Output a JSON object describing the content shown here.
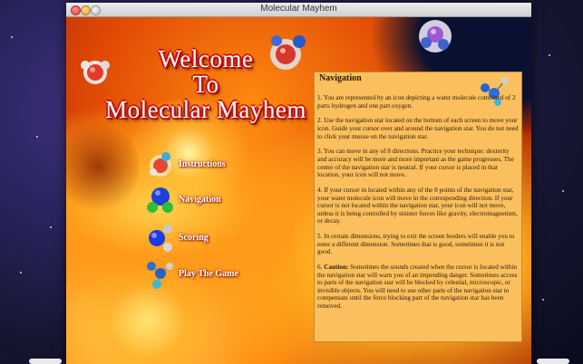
{
  "window": {
    "title": "Molecular Mayhem"
  },
  "welcome": {
    "line1": "Welcome",
    "line2": "To",
    "line3": "Molecular Mayhem"
  },
  "menu": {
    "items": [
      {
        "label": "Instructions",
        "icon": "water-molecule-icon"
      },
      {
        "label": "Navigation",
        "icon": "blue-green-molecule-icon"
      },
      {
        "label": "Scoring",
        "icon": "blue-silver-molecule-icon"
      },
      {
        "label": "Play The Game",
        "icon": "chain-molecule-icon"
      }
    ]
  },
  "nav_panel": {
    "title": "Navigation",
    "p1": "1. You are represented by an icon depicting a water molecule combined of 2 parts hydrogen and one part oxygen.",
    "p2": "2. Use the navigation star  located on the bottom of each screen to move your icon.  Guide your cursor over and around the navigation star. You do not need to click your mouse on the navigation star.",
    "p3": "3. You can move in any of 8 directions. Practice your technique: dexterity and accuracy will be more and more important as the game progresses.  The center of the navigation star is neutral.  If your cursor is placed in that location, your icon will not move.",
    "p4": "4. If  your cursor in located within any of the 8 points of the navigation star, your water molecule icon will move in the corresponding direction. If your cursor is not located within the navigation star, your icon will not move, unless it is being controlled by sinister forces like gravity, electromagnetism, or decay.",
    "p5": "5. In certain dimensions,  trying to exit the screen borders will enable you to enter a different dimension. Sometimes that is good, sometimes it is not good.",
    "p6_label": "Caution:",
    "p6_prefix": "6. ",
    "p6": " Sometimes the sounds created when the cursor is located within the navigation star will warn you of an impending danger. Sometimes access to parts of the navigation star will be blocked by celestial, microscopic, or invisible objects. You will need to use other parts of the navigation star to compensate until the force blocking part of the navigation star has been removed."
  },
  "colors": {
    "title_outline": "#c81010",
    "panel_bg": "#fbbf5e",
    "label_text": "#ffffff"
  }
}
